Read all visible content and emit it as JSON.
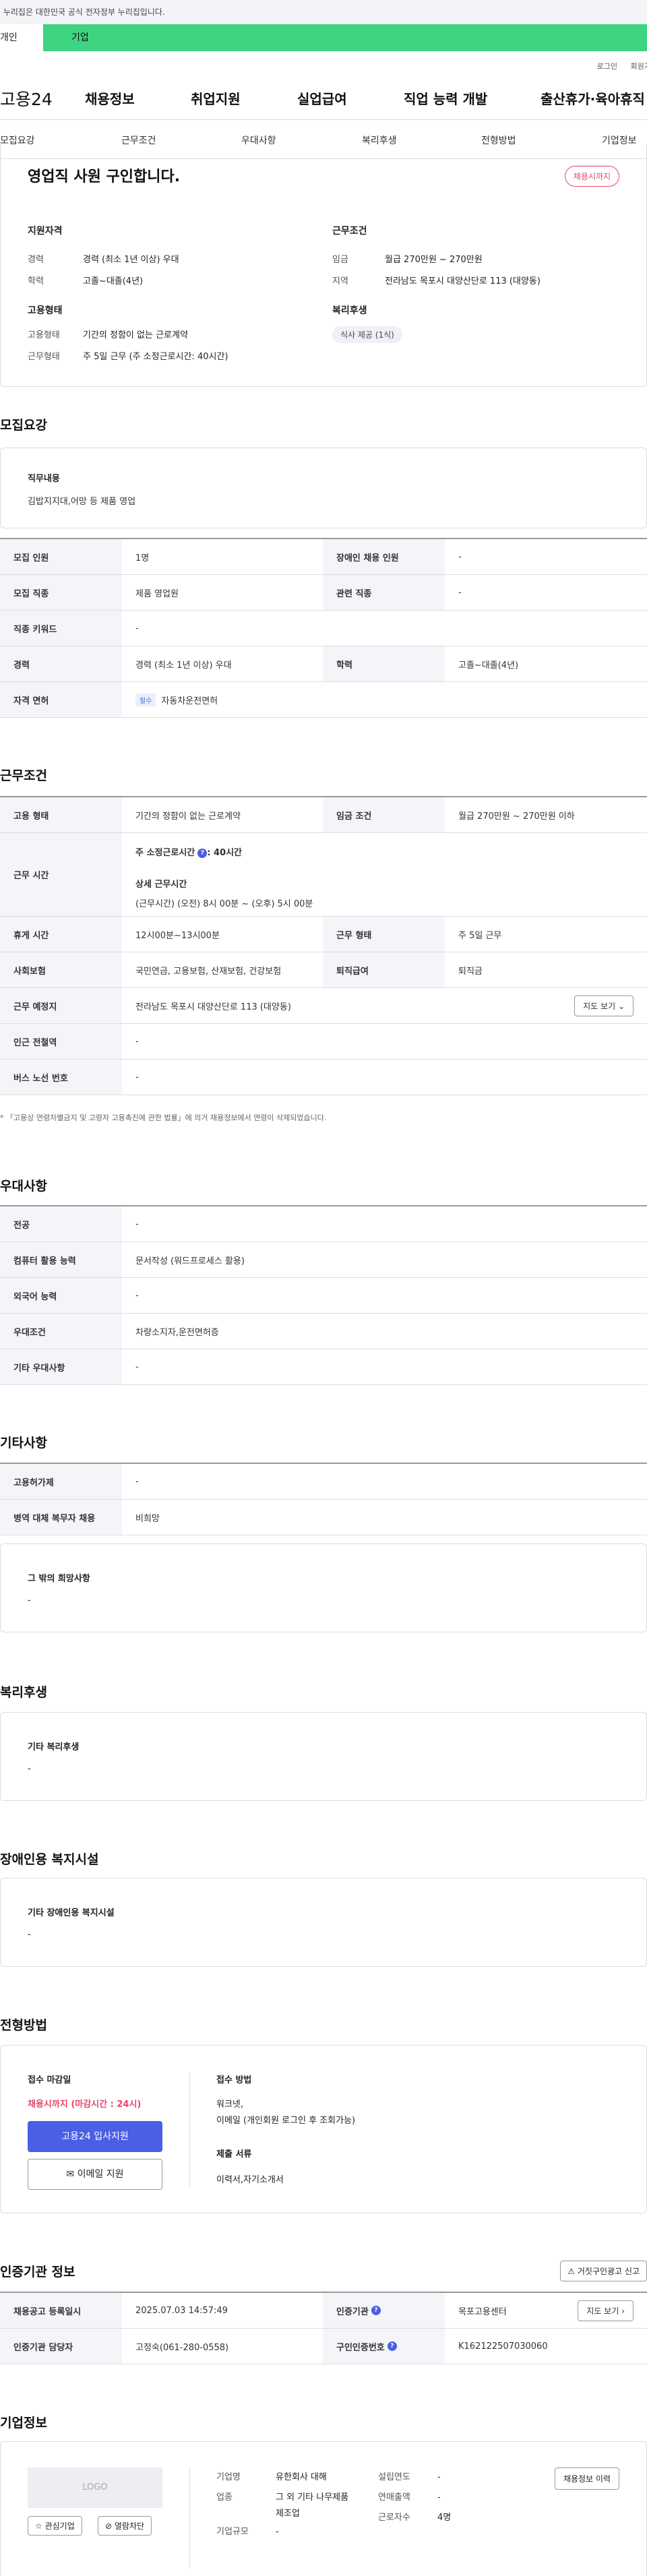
{
  "gov_banner": "이 누리집은 대한민국 공식 전자정부 누리집입니다.",
  "tabs": {
    "personal": "개인",
    "company": "기업"
  },
  "util": {
    "login": "로그인",
    "join": "회원가입"
  },
  "gnb": {
    "logo": "고용24",
    "menu": [
      "채용정보",
      "취업지원",
      "실업급여",
      "직업 능력 개발",
      "출산휴가·육아휴직"
    ]
  },
  "snb": [
    "모집요강",
    "근무조건",
    "우대사항",
    "복리후생",
    "전형방법",
    "기업정보"
  ],
  "summary": {
    "title": "영업직 사원 구인합니다.",
    "status": "채용시까지",
    "req_h": "지원자격",
    "req": [
      {
        "k": "경력",
        "v": "경력 (최소 1년 이상) 우대"
      },
      {
        "k": "학력",
        "v": "고졸~대졸(4년)"
      }
    ],
    "cond_h": "근무조건",
    "cond": [
      {
        "k": "임금",
        "v": "월급 270만원 ~ 270만원"
      },
      {
        "k": "지역",
        "v": "전라남도 목포시 대양산단로 113 (대양동)"
      }
    ],
    "emp_h": "고용형태",
    "emp": [
      {
        "k": "고용형태",
        "v": "기간의 정함이 없는 근로계약"
      },
      {
        "k": "근무형태",
        "v": "주 5일 근무 (주 소정근로시간: 40시간)"
      }
    ],
    "welfare_h": "복리후생",
    "welfare_pill": "식사 제공 (1식)"
  },
  "recruit": {
    "title": "모집요강",
    "duty_h": "직무내용",
    "duty": "김밥지지대,어망 등 제품 영업",
    "rows": [
      {
        "k": "모집 인원",
        "v": "1명",
        "k2": "장애인 채용 인원",
        "v2": "-"
      },
      {
        "k": "모집 직종",
        "v": "제품 영업원",
        "k2": "관련 직종",
        "v2": "-"
      },
      {
        "k": "직종 키워드",
        "v": "-"
      },
      {
        "k": "경력",
        "v": "경력 (최소 1년 이상) 우대",
        "k2": "학력",
        "v2": "고졸~대졸(4년)"
      },
      {
        "k": "자격 면허",
        "badge": "필수",
        "v": "자동차운전면허"
      }
    ]
  },
  "work": {
    "title": "근무조건",
    "r1": {
      "k": "고용 형태",
      "v": "기간의 정함이 없는 근로계약",
      "k2": "임금 조건",
      "v2": "월급 270만원 ~ 270만원 이하"
    },
    "hours": {
      "k": "근무 시간",
      "a": "주 소정근로시간",
      "a_v": ": 40시간",
      "b": "상세 근무시간",
      "c": "(근무시간) (오전) 8시 00분 ~ (오후) 5시 00분"
    },
    "r3": {
      "k": "휴게 시간",
      "v": "12시00분~13시00분",
      "k2": "근무 형태",
      "v2": "주 5일 근무"
    },
    "r4": {
      "k": "사회보험",
      "v": "국민연금, 고용보험, 산재보험, 건강보험",
      "k2": "퇴직급여",
      "v2": "퇴직금"
    },
    "r5": {
      "k": "근무 예정지",
      "v": "전라남도 목포시 대양산단로 113 (대양동)",
      "btn": "지도 보기"
    },
    "r6": {
      "k": "인근 전철역",
      "v": "-"
    },
    "r7": {
      "k": "버스 노선 번호",
      "v": "-"
    },
    "note": "「고용상 연령차별금지 및 고령자 고용촉진에 관한 법률」에 의거 채용정보에서 연령이 삭제되었습니다."
  },
  "pref": {
    "title": "우대사항",
    "rows": [
      {
        "k": "전공",
        "v": "-"
      },
      {
        "k": "컴퓨터 활용 능력",
        "v": "문서작성 (워드프로세스 활용)"
      },
      {
        "k": "외국어 능력",
        "v": "-"
      },
      {
        "k": "우대조건",
        "v": "차량소지자,운전면허증"
      },
      {
        "k": "기타 우대사항",
        "v": "-"
      }
    ]
  },
  "etc": {
    "title": "기타사항",
    "rows": [
      {
        "k": "고용허가제",
        "v": "-"
      },
      {
        "k": "병역 대체 복무자 채용",
        "v": "비희망"
      }
    ],
    "box_h": "그 밖의 희망사항",
    "box_v": "-"
  },
  "welfare": {
    "title": "복리후생",
    "box_h": "기타 복리후생",
    "box_v": "-"
  },
  "disabled": {
    "title": "장애인용 복지시설",
    "box_h": "기타 장애인용 복지시설",
    "box_v": "-"
  },
  "process": {
    "title": "전형방법",
    "deadline_h": "접수 마감일",
    "deadline_v": "채용시까지 (마감시간 : 24시)",
    "apply_btn": "고용24 입사지원",
    "email_btn": "이메일 지원",
    "method_h": "접수 방법",
    "method_v1": "워크넷,",
    "method_v2": "이메일 (개인회원 로그인 후 조회가능)",
    "docs_h": "제출 서류",
    "docs_v": "이력서,자기소개서"
  },
  "cert": {
    "title": "인증기관 정보",
    "report_btn": "거짓구인광고 신고",
    "r1": {
      "k": "채용공고 등록일시",
      "v": "2025.07.03 14:57:49",
      "k2": "인증기관",
      "v2": "목포고용센터",
      "btn": "지도 보기"
    },
    "r2": {
      "k": "인증기관 담당자",
      "v": "고정숙(061-280-0558)",
      "k2": "구인인증번호",
      "v2": "K162122507030060"
    }
  },
  "company": {
    "title": "기업정보",
    "logo": "LOGO",
    "fav_btn": "관심기업",
    "block_btn": "열람차단",
    "name_k": "기업명",
    "name_v": "유한회사 대해",
    "ind_k": "업종",
    "ind_v": "그 외 기타 나무제품 제조업",
    "size_k": "기업규모",
    "size_v": "-",
    "year_k": "설립연도",
    "year_v": "-",
    "sales_k": "연매출액",
    "sales_v": "-",
    "emp_k": "근로자수",
    "emp_v": "4명",
    "history_btn": "채용정보 이력"
  }
}
